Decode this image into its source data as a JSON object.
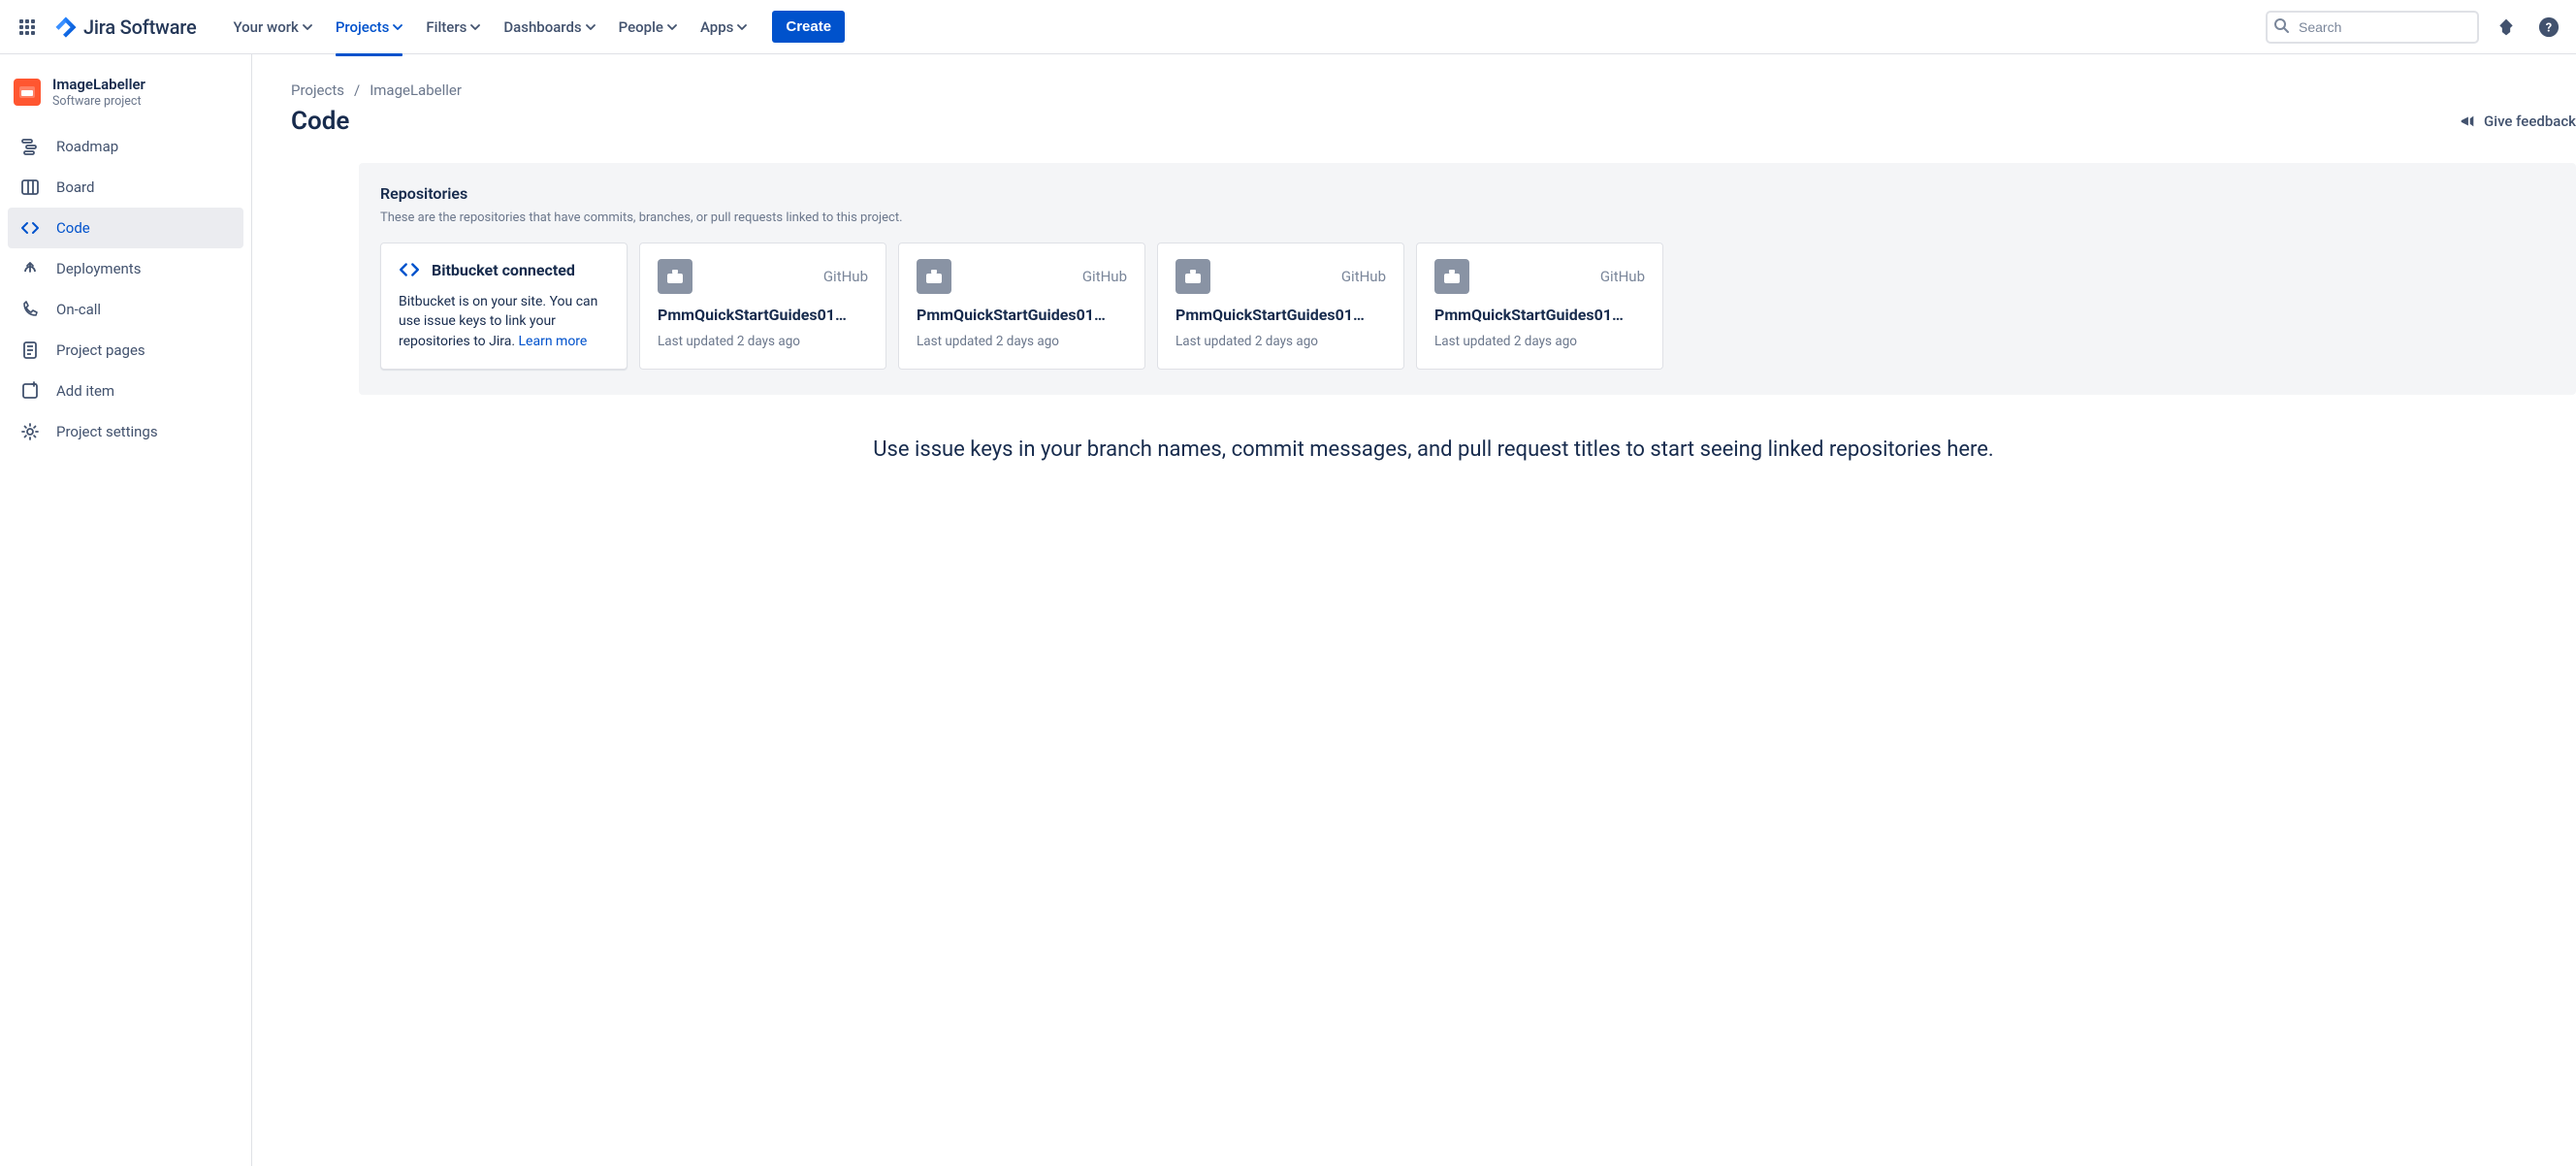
{
  "branding": {
    "product_name": "Jira Software"
  },
  "topnav": {
    "items": [
      {
        "label": "Your work"
      },
      {
        "label": "Projects"
      },
      {
        "label": "Filters"
      },
      {
        "label": "Dashboards"
      },
      {
        "label": "People"
      },
      {
        "label": "Apps"
      }
    ],
    "active_index": 1,
    "create_label": "Create",
    "search_placeholder": "Search",
    "feedback_label": "Give feedback"
  },
  "sidebar": {
    "project": {
      "name": "ImageLabeller",
      "type": "Software project"
    },
    "items": [
      {
        "label": "Roadmap",
        "icon": "roadmap-icon"
      },
      {
        "label": "Board",
        "icon": "board-icon"
      },
      {
        "label": "Code",
        "icon": "code-icon"
      },
      {
        "label": "Deployments",
        "icon": "deployments-icon"
      },
      {
        "label": "On-call",
        "icon": "on-call-icon"
      },
      {
        "label": "Project pages",
        "icon": "project-pages-icon"
      },
      {
        "label": "Add item",
        "icon": "add-item-icon"
      },
      {
        "label": "Project settings",
        "icon": "settings-icon"
      }
    ],
    "active_index": 2
  },
  "breadcrumbs": [
    "Projects",
    "ImageLabeller"
  ],
  "page": {
    "title": "Code"
  },
  "repositories_panel": {
    "heading": "Repositories",
    "description": "These are the repositories that have commits, branches, or pull requests linked to this project.",
    "connected_card": {
      "title": "Bitbucket connected",
      "body": "Bitbucket is on your site. You can use issue keys to link your repositories to Jira.",
      "learn_more": "Learn more"
    },
    "repos": [
      {
        "provider": "GitHub",
        "name": "PmmQuickStartGuides01…",
        "updated": "Last updated 2 days ago"
      },
      {
        "provider": "GitHub",
        "name": "PmmQuickStartGuides01…",
        "updated": "Last updated 2 days ago"
      },
      {
        "provider": "GitHub",
        "name": "PmmQuickStartGuides01…",
        "updated": "Last updated 2 days ago"
      },
      {
        "provider": "GitHub",
        "name": "PmmQuickStartGuides01…",
        "updated": "Last updated 2 days ago"
      }
    ]
  },
  "empty_hint": "Use issue keys in your branch names, commit messages, and pull request titles to start seeing linked repositories here."
}
